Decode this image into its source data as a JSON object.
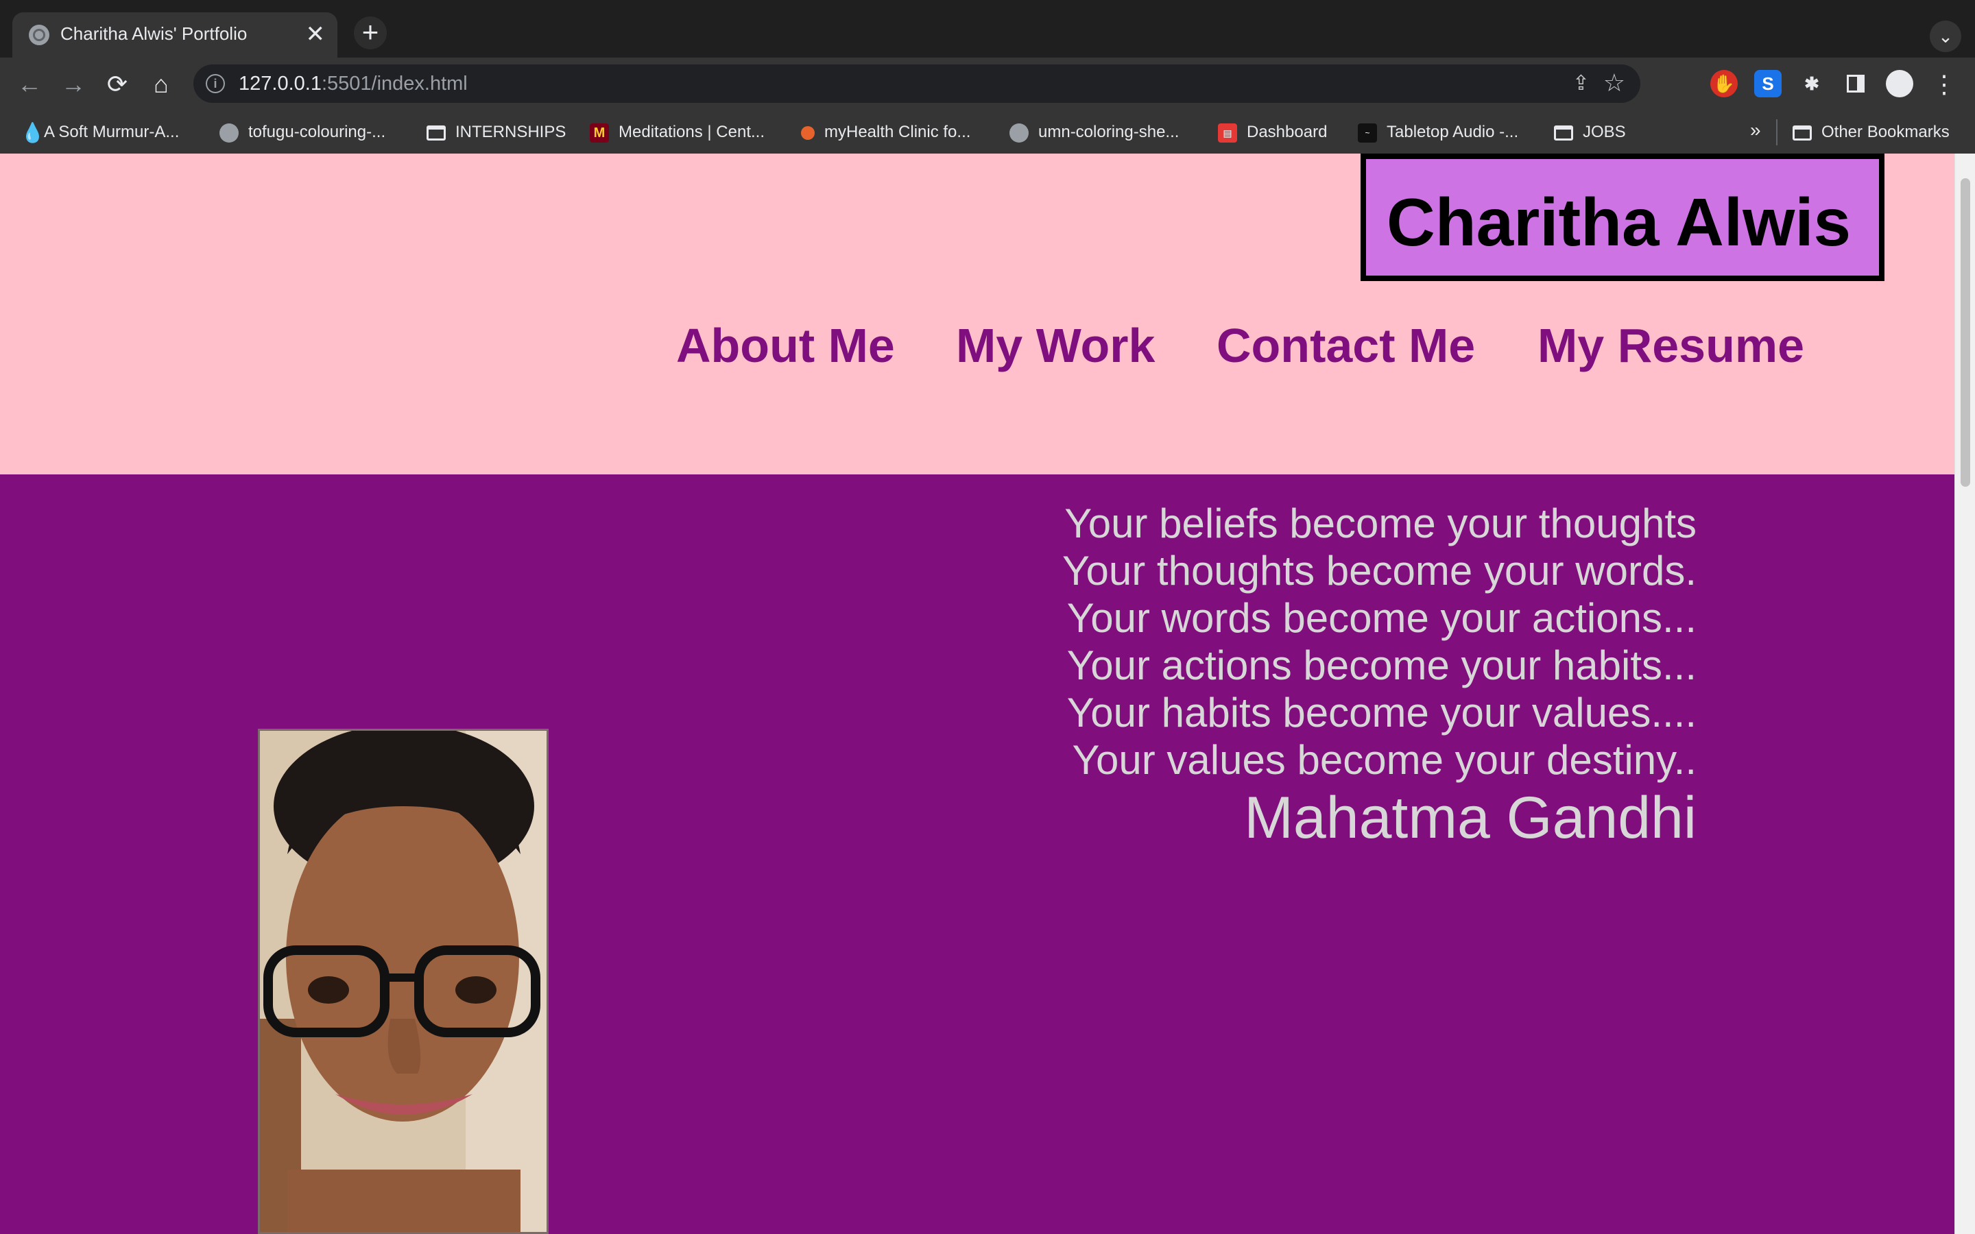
{
  "tab": {
    "title": "Charitha Alwis' Portfolio",
    "close": "✕"
  },
  "newtab": "+",
  "tabmenu": "⌄",
  "toolbar": {
    "back": "←",
    "forward": "→",
    "reload": "⟳",
    "home": "⌂",
    "info": "i",
    "url_host": "127.0.0.1",
    "url_rest": ":5501/index.html",
    "share": "⇪",
    "star": "☆",
    "menu": "⋮"
  },
  "bookmarks": [
    {
      "label": "A Soft Murmur-A..."
    },
    {
      "label": "tofugu-colouring-..."
    },
    {
      "label": "INTERNSHIPS"
    },
    {
      "label": "Meditations | Cent..."
    },
    {
      "label": "myHealth Clinic fo..."
    },
    {
      "label": "umn-coloring-she..."
    },
    {
      "label": "Dashboard"
    },
    {
      "label": "Tabletop Audio -..."
    },
    {
      "label": "JOBS"
    },
    {
      "label": "Other Bookmarks"
    }
  ],
  "bookmarks_more": "»",
  "page": {
    "brand": "Charitha Alwis",
    "nav": [
      "About Me",
      "My Work",
      "Contact Me",
      "My Resume"
    ],
    "quote_lines": [
      "Your beliefs become your thoughts",
      "Your thoughts become your words.",
      "Your words become your actions...",
      "Your actions become your habits...",
      "Your habits become your values....",
      "Your values become your destiny.."
    ],
    "author": "Mahatma Gandhi"
  },
  "colors": {
    "header_bg": "#ffc0cb",
    "page_bg": "#800e7d",
    "brand_bg": "#cd73e4",
    "nav_text": "#7f0f7e",
    "quote_text": "#d7d7d7"
  }
}
